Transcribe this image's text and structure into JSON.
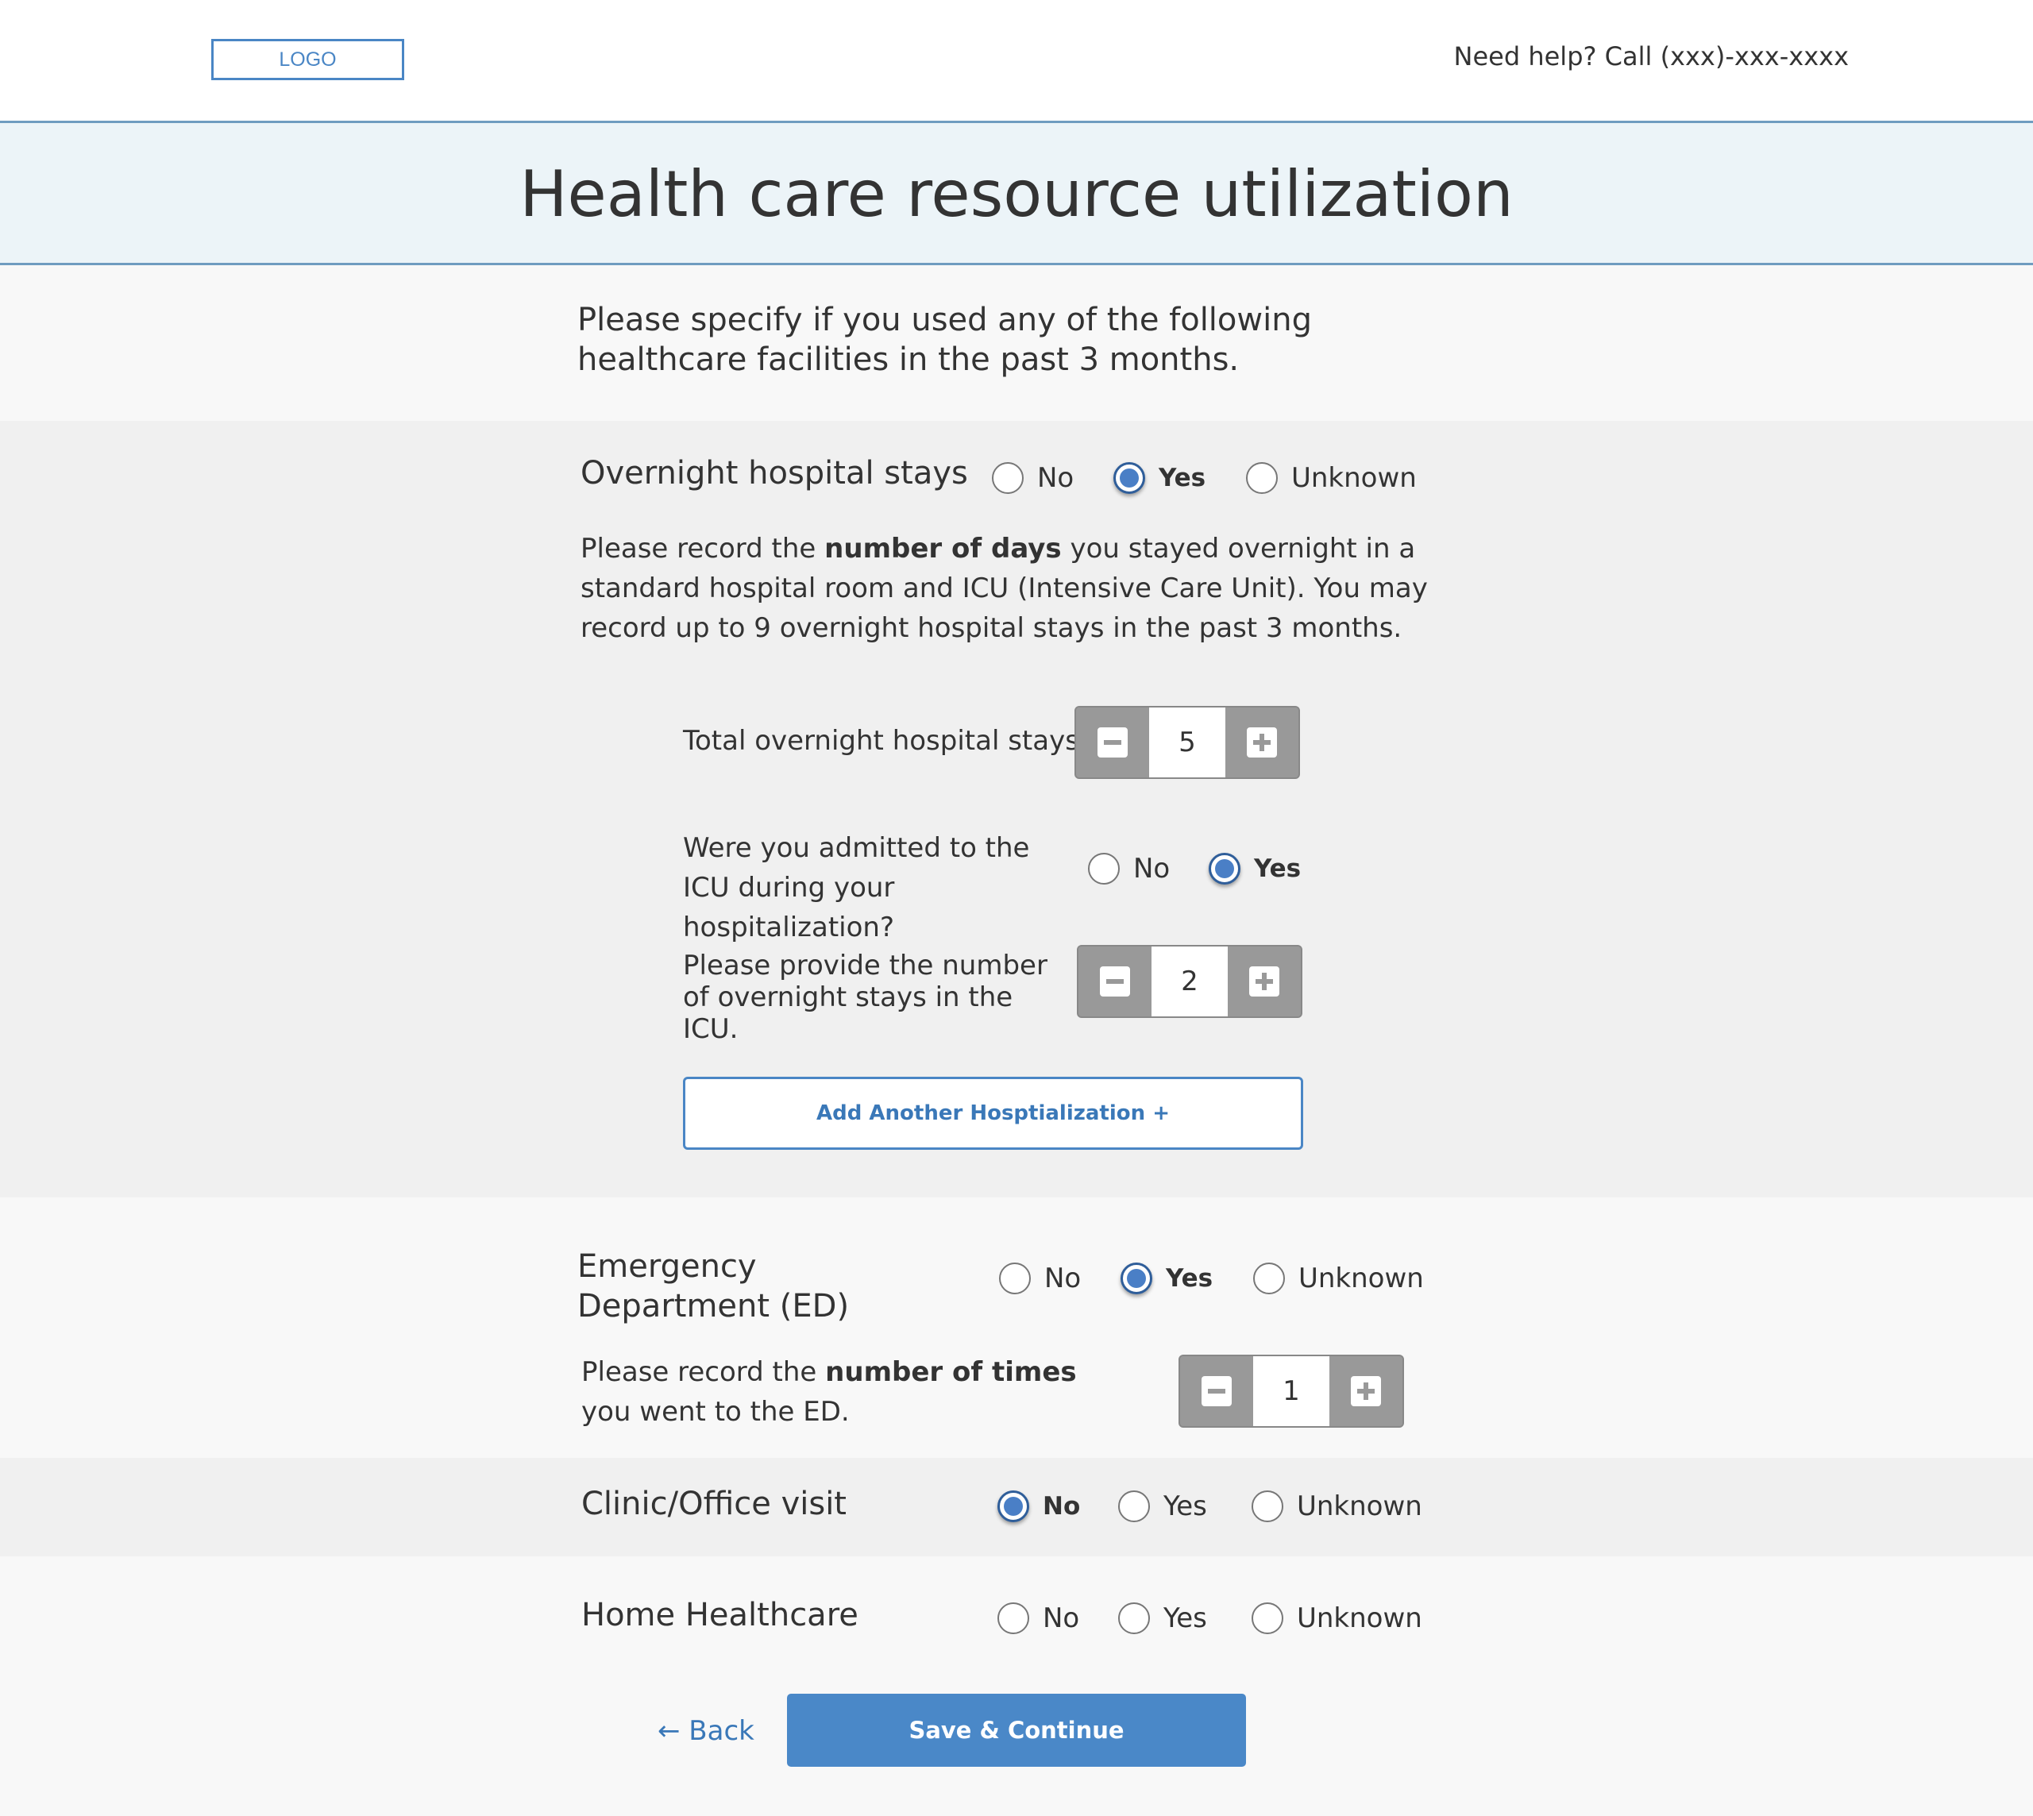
{
  "header": {
    "logo_text": "LOGO",
    "help_text": "Need help? Call (xxx)-xxx-xxxx"
  },
  "page": {
    "title": "Health care resource utilization",
    "intro": "Please specify if you used any of the following healthcare facilities in the past 3 months."
  },
  "hospital": {
    "label": "Overnight hospital stays",
    "options": [
      "No",
      "Yes",
      "Unknown"
    ],
    "selected": "Yes",
    "instr_before": "Please record the ",
    "instr_bold": "number of days",
    "instr_after": " you stayed overnight in a standard hospital room and ICU (Intensive Care Unit). You may record up to 9 overnight hospital stays in the past 3 months.",
    "total_label": "Total overnight hospital stays",
    "total_value": "5",
    "icu_question": "Were you admitted to the ICU during your hospitalization?",
    "icu_options": [
      "No",
      "Yes"
    ],
    "icu_selected": "Yes",
    "icu_count_label": "Please provide the number of overnight stays in the ICU.",
    "icu_count_value": "2",
    "add_button": "Add Another Hosptialization +"
  },
  "ed": {
    "label": "Emergency Department (ED)",
    "options": [
      "No",
      "Yes",
      "Unknown"
    ],
    "selected": "Yes",
    "instr_before": "Please record the ",
    "instr_bold": "number of times",
    "instr_after": " you went to the ED.",
    "count_value": "1"
  },
  "clinic": {
    "label": "Clinic/Office visit",
    "options": [
      "No",
      "Yes",
      "Unknown"
    ],
    "selected": "No"
  },
  "home": {
    "label": "Home Healthcare",
    "options": [
      "No",
      "Yes",
      "Unknown"
    ],
    "selected": ""
  },
  "footer": {
    "back_label": "← Back",
    "save_label": "Save & Continue"
  },
  "colors": {
    "accent": "#4a88c8",
    "banner_bg": "#ecf4f8",
    "section_bg": "#f0f0f0",
    "stepper_gray": "#999999"
  }
}
